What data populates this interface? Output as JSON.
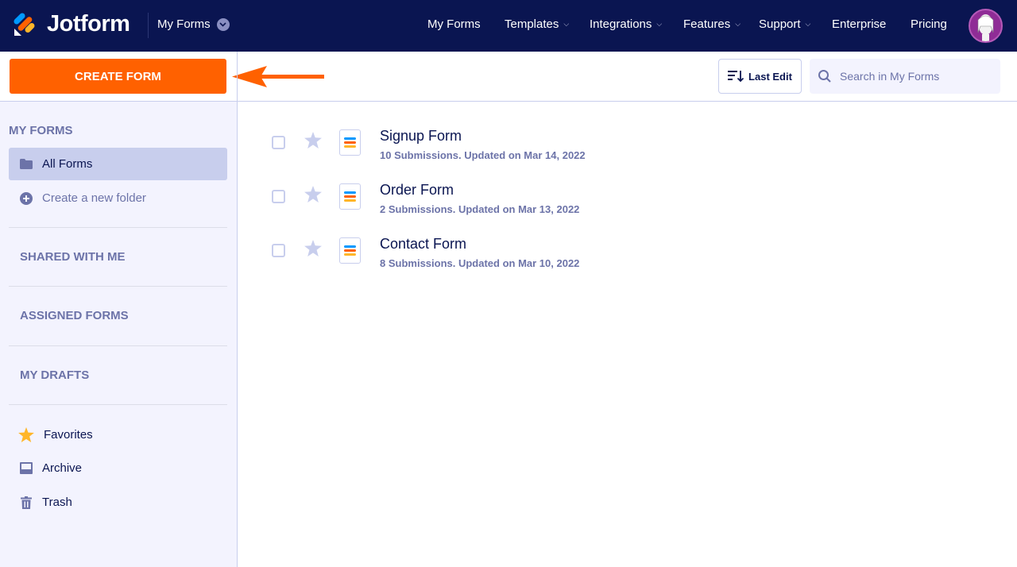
{
  "header": {
    "brand": "Jotform",
    "workspace_label": "My Forms",
    "nav": [
      {
        "label": "My Forms",
        "has_dropdown": false
      },
      {
        "label": "Templates",
        "has_dropdown": true
      },
      {
        "label": "Integrations",
        "has_dropdown": true
      },
      {
        "label": "Features",
        "has_dropdown": true
      },
      {
        "label": "Support",
        "has_dropdown": true
      },
      {
        "label": "Enterprise",
        "has_dropdown": false
      },
      {
        "label": "Pricing",
        "has_dropdown": false
      }
    ],
    "caret": "⌄"
  },
  "toolbar": {
    "create_label": "CREATE FORM",
    "sort_label": "Last Edit",
    "search_placeholder": "Search in My Forms"
  },
  "sidebar": {
    "my_forms_title": "MY FORMS",
    "all_forms": "All Forms",
    "new_folder": "Create a new folder",
    "sections": [
      "SHARED WITH ME",
      "ASSIGNED FORMS",
      "MY DRAFTS"
    ],
    "bottom_items": [
      {
        "label": "Favorites",
        "icon": "star-icon"
      },
      {
        "label": "Archive",
        "icon": "archive-icon"
      },
      {
        "label": "Trash",
        "icon": "trash-icon"
      }
    ]
  },
  "forms": [
    {
      "name": "Signup Form",
      "meta": "10 Submissions. Updated on Mar 14, 2022"
    },
    {
      "name": "Order Form",
      "meta": "2 Submissions. Updated on Mar 13, 2022"
    },
    {
      "name": "Contact Form",
      "meta": "8 Submissions. Updated on Mar 10, 2022"
    }
  ],
  "colors": {
    "brand_navy": "#0a1551",
    "accent_orange": "#ff6100",
    "sidebar_bg": "#f3f3fe",
    "active_bg": "#c8ceed",
    "muted_text": "#6c73a8",
    "favorite_star": "#ffb629"
  }
}
